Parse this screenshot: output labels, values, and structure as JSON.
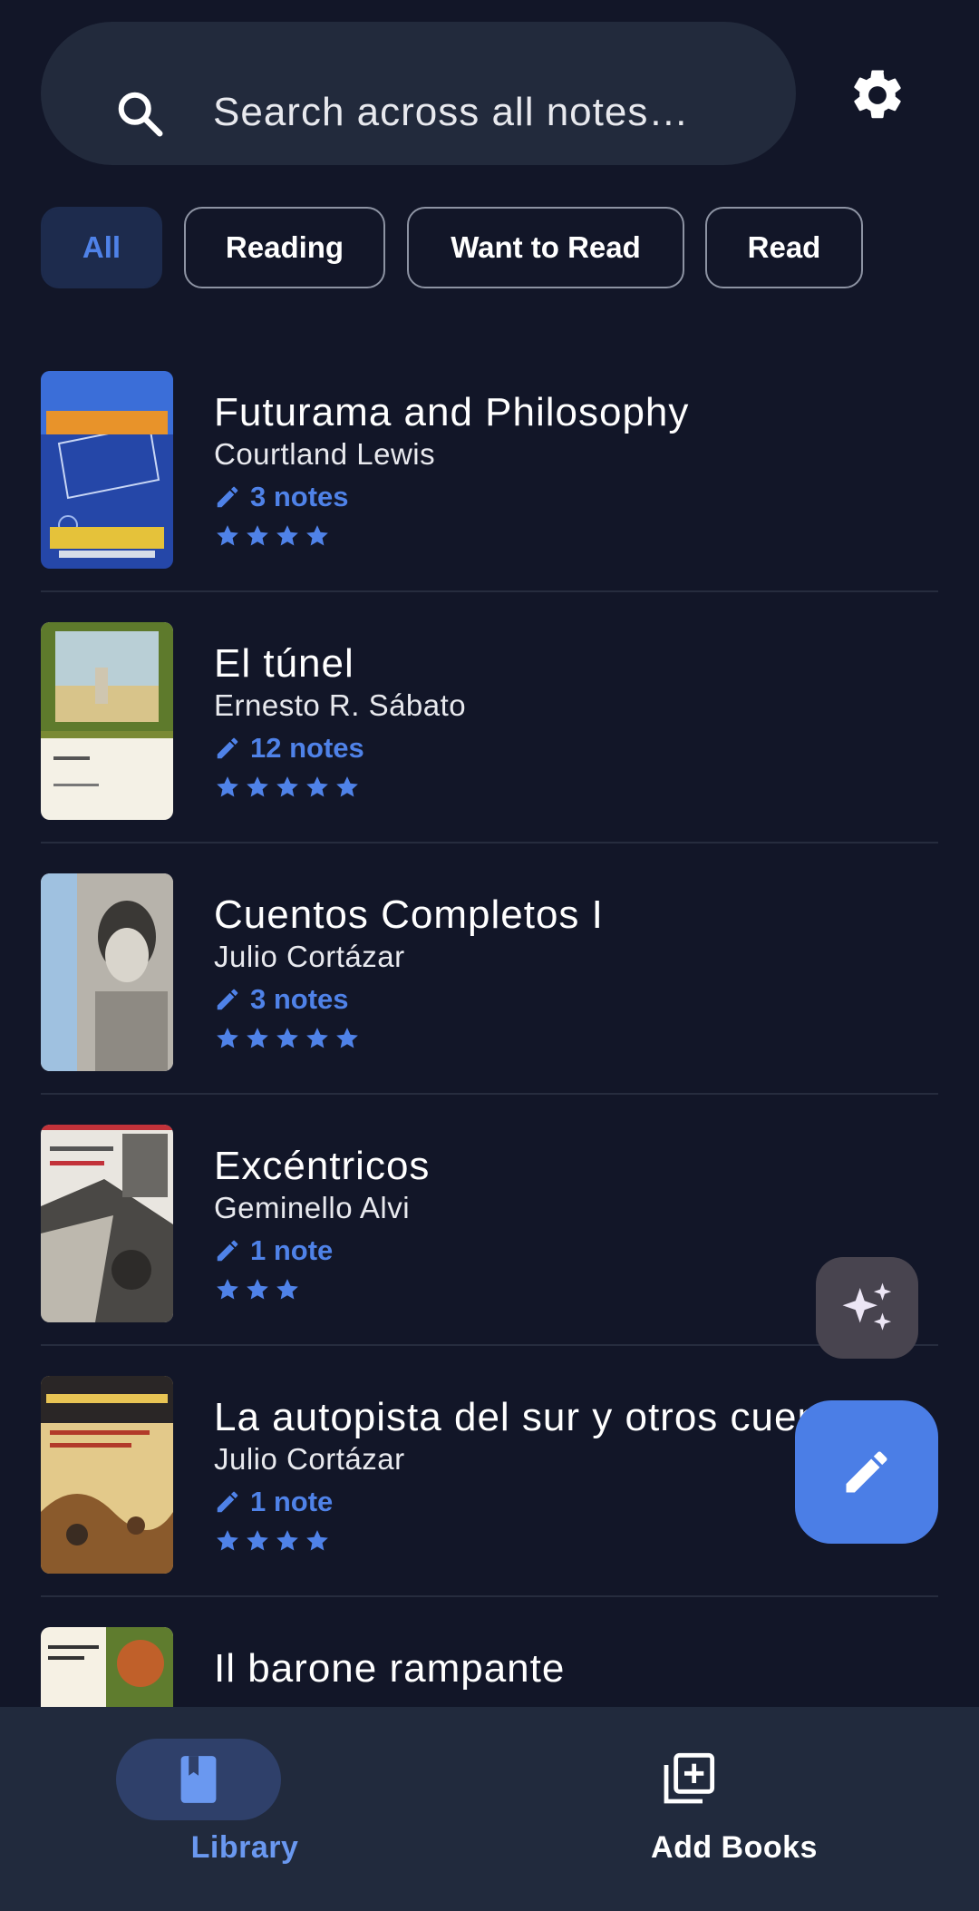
{
  "search": {
    "placeholder": "Search across all notes…"
  },
  "filters": [
    {
      "label": "All",
      "selected": true
    },
    {
      "label": "Reading",
      "selected": false
    },
    {
      "label": "Want to Read",
      "selected": false
    },
    {
      "label": "Read",
      "selected": false
    }
  ],
  "books": [
    {
      "title": "Futurama and Philosophy",
      "author": "Courtland Lewis",
      "notes": "3 notes",
      "rating": 4
    },
    {
      "title": "El túnel",
      "author": "Ernesto R. Sábato",
      "notes": "12 notes",
      "rating": 5
    },
    {
      "title": "Cuentos Completos I",
      "author": "Julio Cortázar",
      "notes": "3 notes",
      "rating": 5
    },
    {
      "title": "Excéntricos",
      "author": "Geminello Alvi",
      "notes": "1 note",
      "rating": 3
    },
    {
      "title": "La autopista del sur y otros cuentos",
      "author": "Julio Cortázar",
      "notes": "1 note",
      "rating": 4
    },
    {
      "title": "Il barone rampante",
      "author": "",
      "notes": "",
      "rating": 0
    }
  ],
  "nav": {
    "library_label": "Library",
    "add_books_label": "Add Books"
  },
  "colors": {
    "background": "#121628",
    "accent": "#4f82e8",
    "surface": "#222a3c",
    "fab_primary": "#4b7ee6"
  }
}
